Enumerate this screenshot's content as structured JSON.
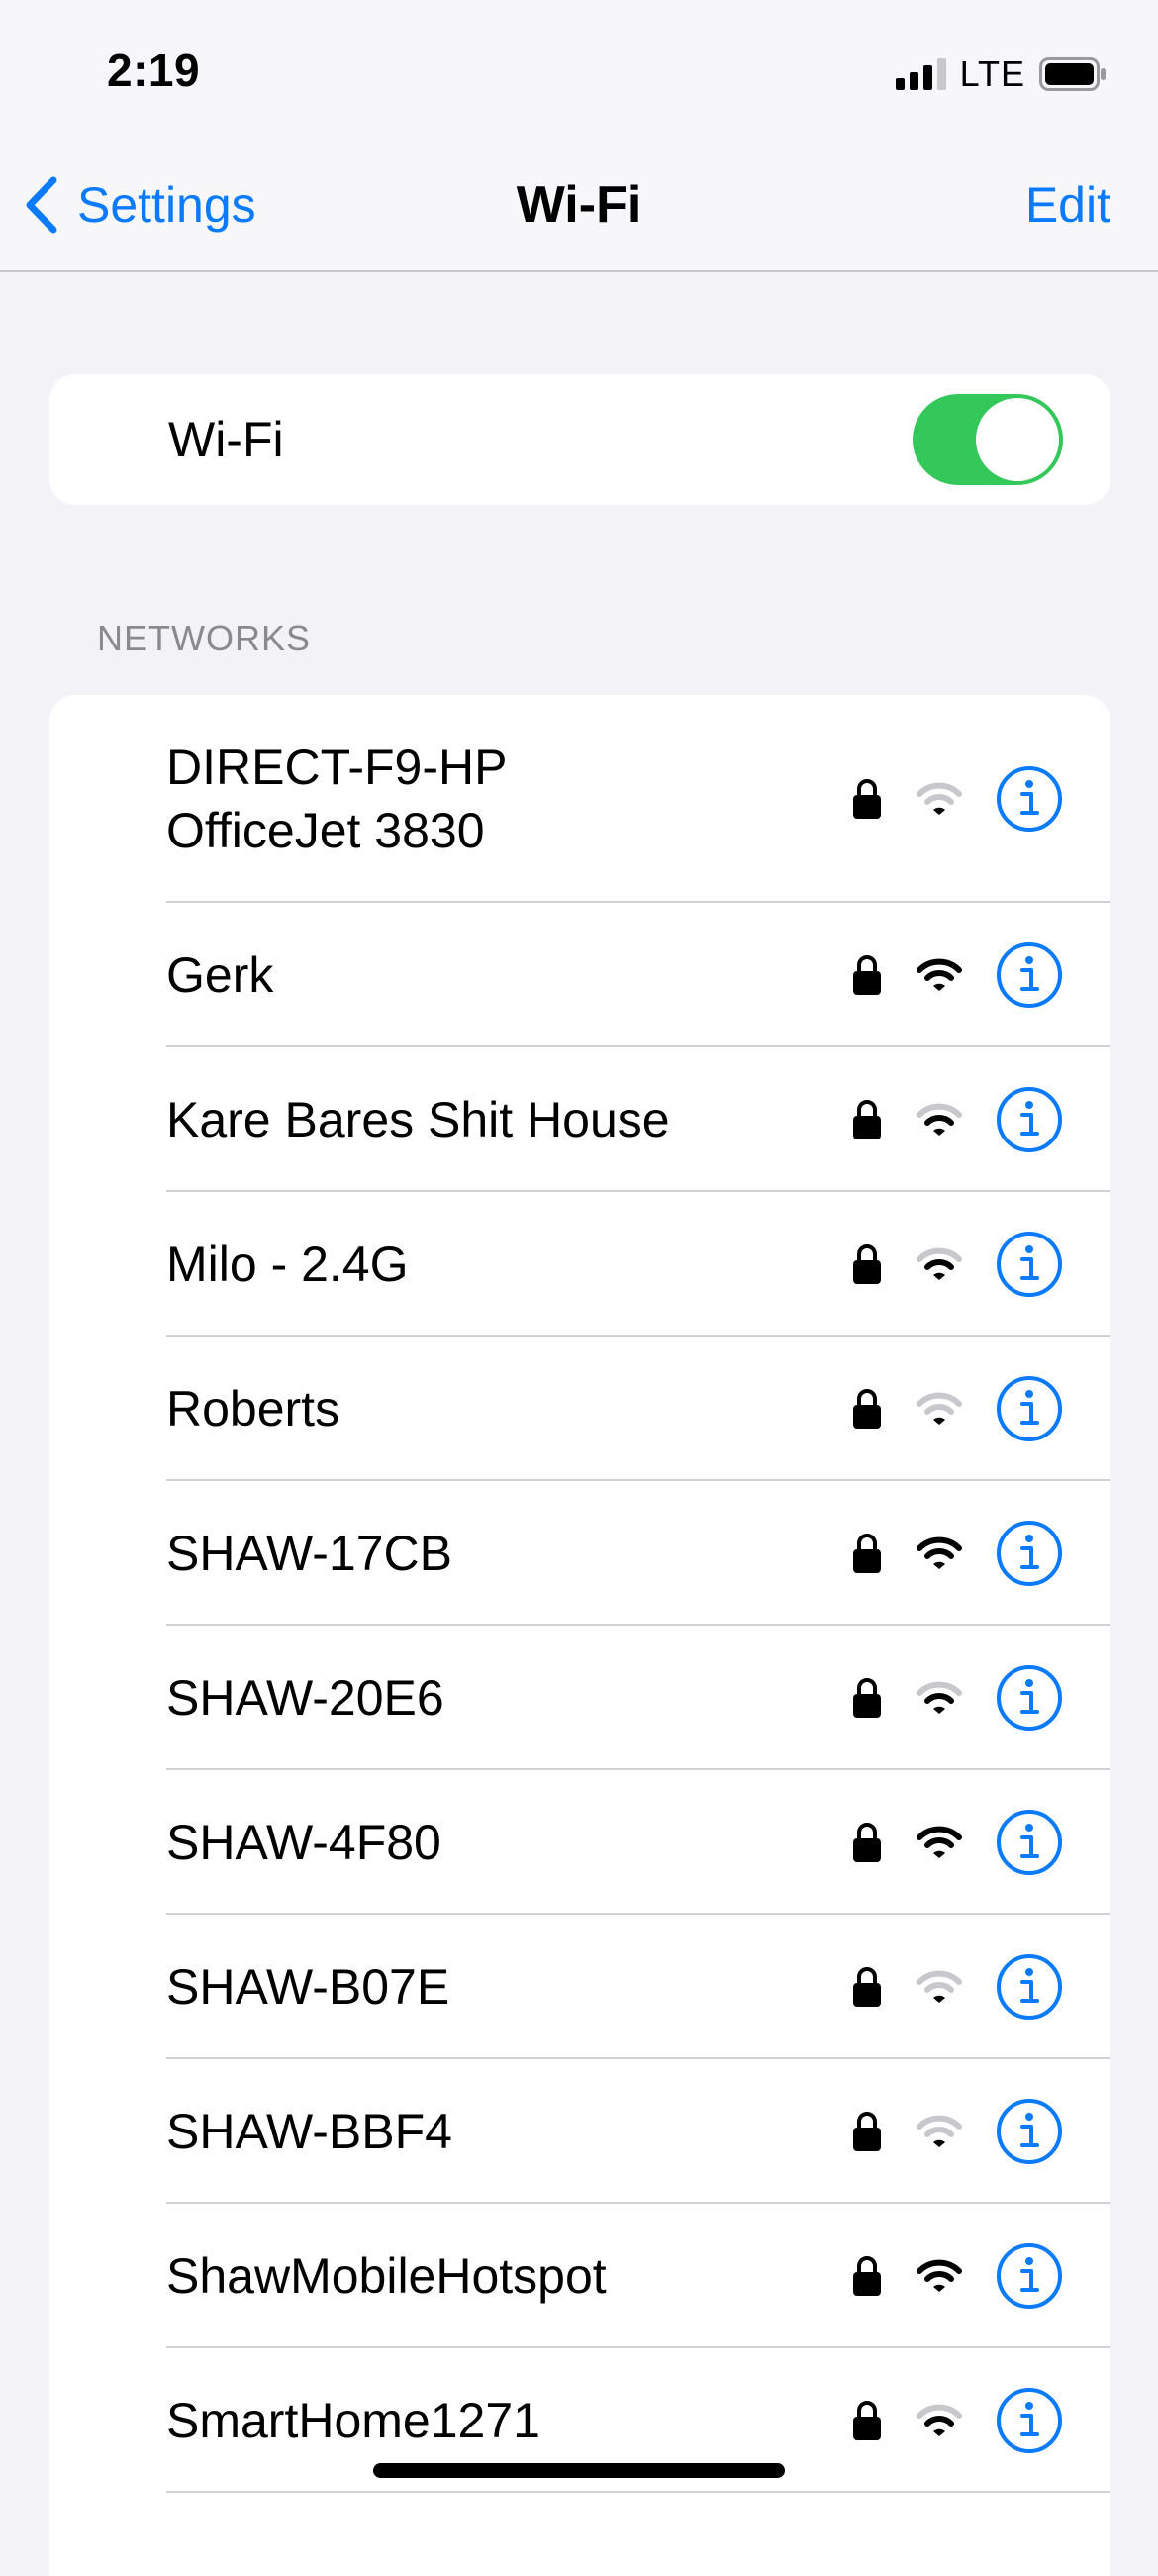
{
  "status_bar": {
    "time": "2:19",
    "carrier": "LTE",
    "icons": [
      "cellular-signal-icon",
      "battery-icon"
    ]
  },
  "nav": {
    "back_label": "Settings",
    "title": "Wi-Fi",
    "edit_label": "Edit",
    "accent_color": "#0a7aff"
  },
  "wifi_toggle": {
    "label": "Wi-Fi",
    "on": true,
    "on_color": "#34c759"
  },
  "networks_section": {
    "header": "NETWORKS",
    "items": [
      {
        "name": "DIRECT-F9-HP\nOfficeJet 3830",
        "secured": true,
        "signal_bars": 1
      },
      {
        "name": "Gerk",
        "secured": true,
        "signal_bars": 3
      },
      {
        "name": "Kare Bares Shit House",
        "secured": true,
        "signal_bars": 2
      },
      {
        "name": "Milo - 2.4G",
        "secured": true,
        "signal_bars": 2
      },
      {
        "name": "Roberts",
        "secured": true,
        "signal_bars": 1
      },
      {
        "name": "SHAW-17CB",
        "secured": true,
        "signal_bars": 3
      },
      {
        "name": "SHAW-20E6",
        "secured": true,
        "signal_bars": 2
      },
      {
        "name": "SHAW-4F80",
        "secured": true,
        "signal_bars": 3
      },
      {
        "name": "SHAW-B07E",
        "secured": true,
        "signal_bars": 1
      },
      {
        "name": "SHAW-BBF4",
        "secured": true,
        "signal_bars": 1
      },
      {
        "name": "ShawMobileHotspot",
        "secured": true,
        "signal_bars": 3
      },
      {
        "name": "SmartHome1271",
        "secured": true,
        "signal_bars": 2
      }
    ]
  }
}
